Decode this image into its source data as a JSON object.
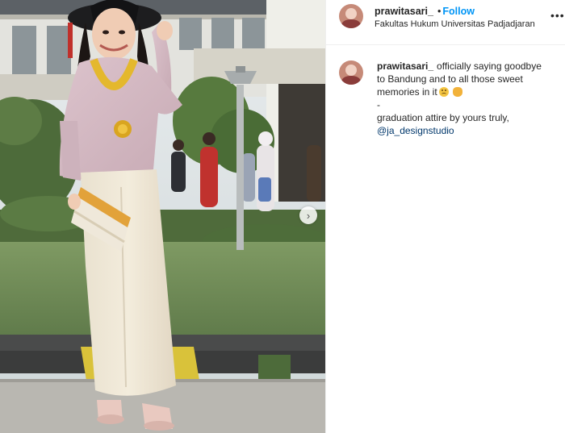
{
  "post": {
    "username": "prawitasari_",
    "follow_label": "Follow",
    "separator": "•",
    "location": "Fakultas Hukum Universitas Padjadjaran"
  },
  "caption": {
    "username": "prawitasari_",
    "line1": "officially saying goodbye",
    "line2": "to Bandung and to all those sweet",
    "line3": "memories in it",
    "line4": "-",
    "line5": "graduation attire by yours truly,",
    "mention": "@ja_designstudio",
    "emoji_1": "sad-face-emoji",
    "emoji_2": "clapping-hands-emoji"
  },
  "icons": {
    "more": "more-options-icon",
    "next": "carousel-next-icon"
  },
  "colors": {
    "link_blue": "#0095f6",
    "mention_blue": "#00376b",
    "text": "#262626",
    "divider": "#efefef"
  }
}
